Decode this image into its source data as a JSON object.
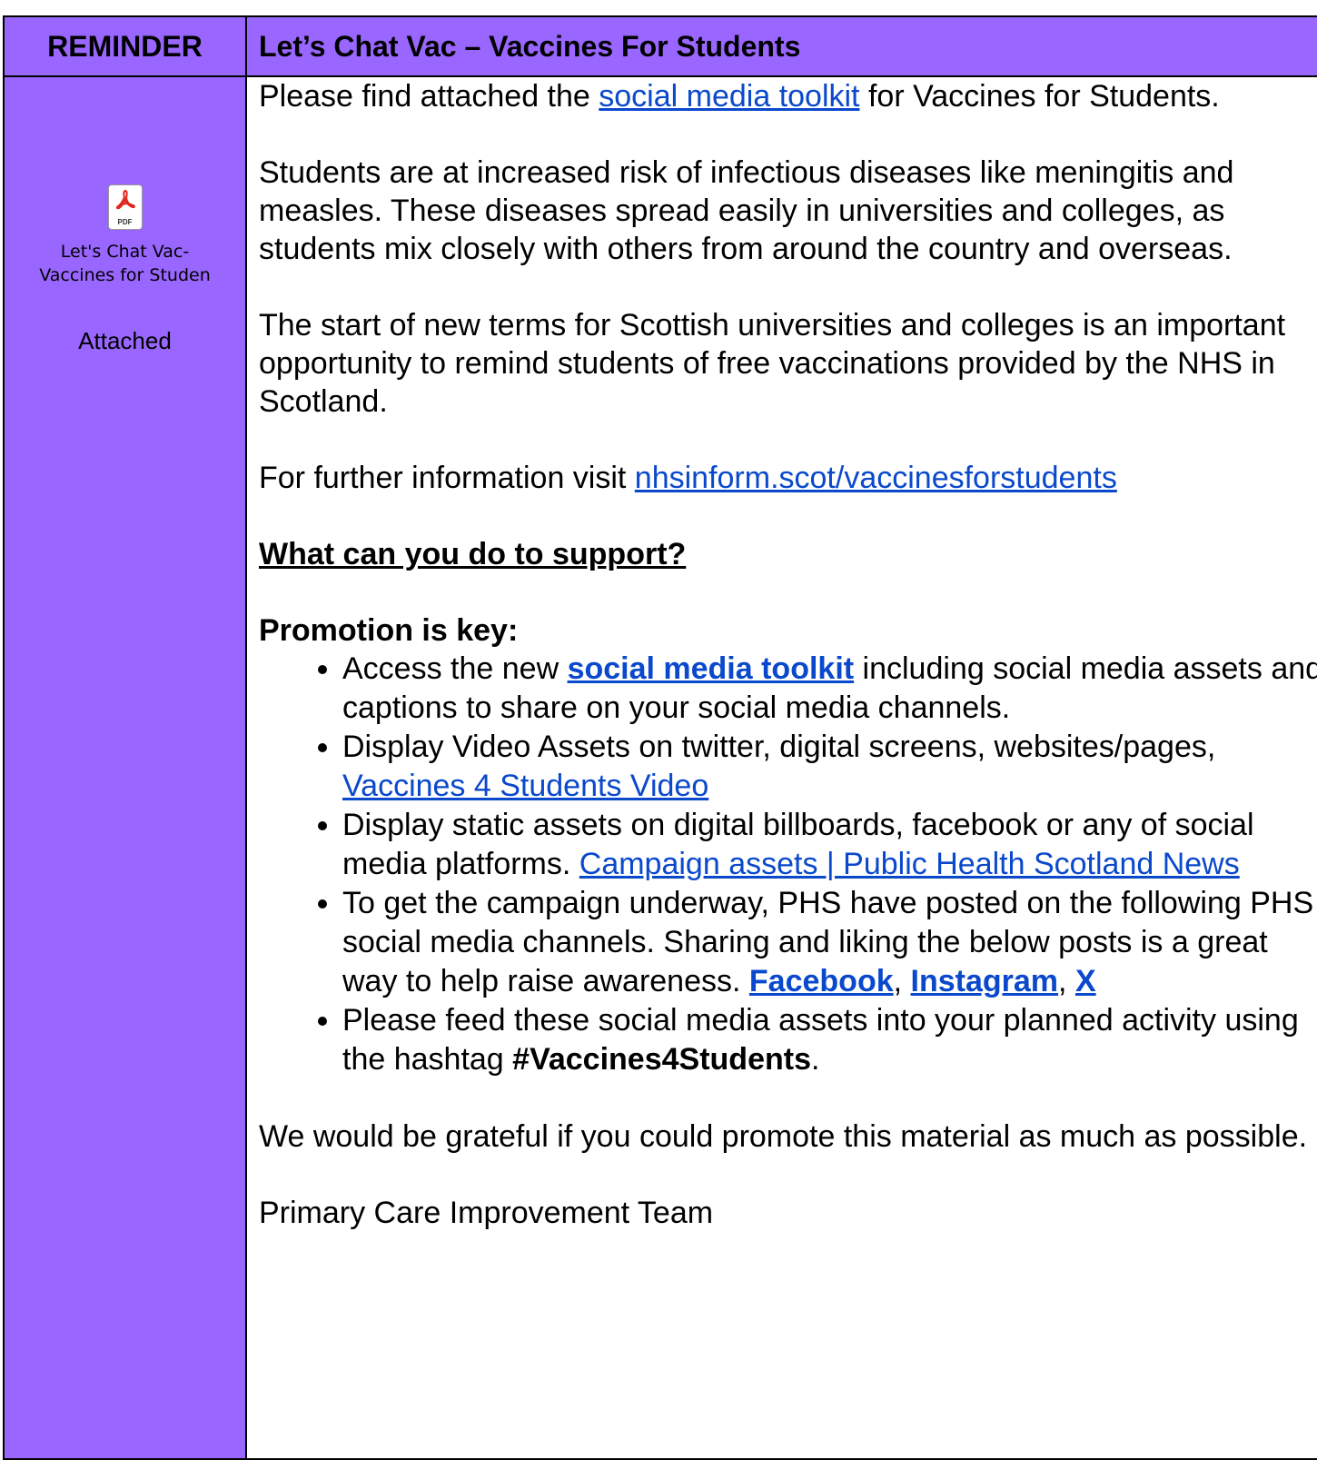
{
  "header": {
    "left_label": "REMINDER",
    "title": "Let’s Chat Vac – Vaccines For Students"
  },
  "attachment": {
    "icon_tag": "PDF",
    "name_line1": "Let's Chat Vac-",
    "name_line2": "Vaccines for Studen",
    "status": "Attached"
  },
  "body": {
    "p1_before": "Please find attached the ",
    "p1_link": "social media toolkit",
    "p1_after": " for Vaccines for Students.",
    "p2": "Students are at increased risk of infectious diseases like meningitis and measles. These diseases spread easily in universities and colleges, as students mix closely with others from around the country and overseas.",
    "p3": "The start of new terms for Scottish universities and colleges is an important opportunity to remind students of free vaccinations provided by the NHS in Scotland.",
    "p4_before": "For further information visit ",
    "p4_link": "nhsinform.scot/vaccinesforstudents",
    "support_heading": "What can you do to support?",
    "promotion_heading": "Promotion is key:",
    "bullets": {
      "b1_before": "Access the new ",
      "b1_link": "social media toolkit",
      "b1_after": " including social media assets and captions to share on your social media channels.",
      "b2_before": "Display Video Assets on twitter, digital screens, websites/pages, ",
      "b2_link": "Vaccines 4 Students Video",
      "b3_before": "Display static assets on digital billboards, facebook or any of social media platforms. ",
      "b3_link": "Campaign assets | Public Health Scotland News",
      "b4_before": "To get the campaign underway, PHS have posted on the following PHS social media channels. Sharing and liking the below posts is a great way to help raise awareness. ",
      "b4_link1": "Facebook",
      "b4_sep1": ", ",
      "b4_link2": "Instagram",
      "b4_sep2": ", ",
      "b4_link3": "X",
      "b5_before": "Please feed these social media assets into your planned activity using the hashtag ",
      "b5_hashtag": "#Vaccines4Students",
      "b5_after": "."
    },
    "p5": "We would be grateful if you could promote this material as much as possible.",
    "signoff": "Primary Care Improvement Team"
  }
}
